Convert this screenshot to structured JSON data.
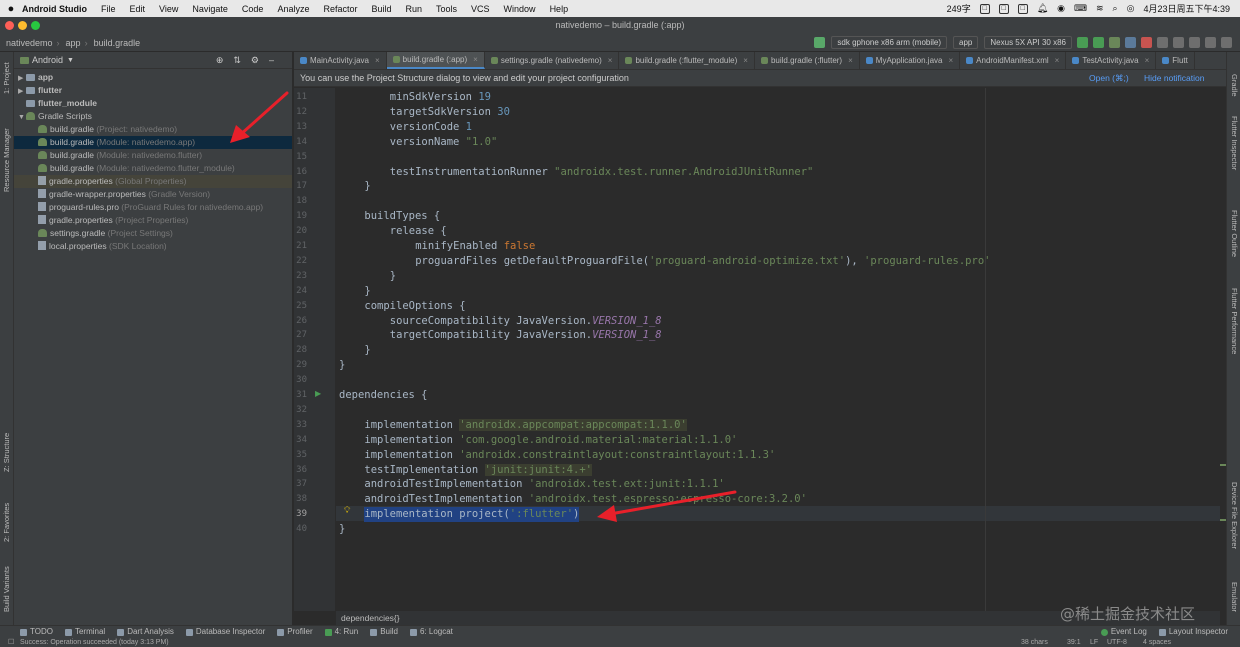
{
  "mac_menu": {
    "app_name": "Android Studio",
    "items": [
      "File",
      "Edit",
      "View",
      "Navigate",
      "Code",
      "Analyze",
      "Refactor",
      "Build",
      "Run",
      "Tools",
      "VCS",
      "Window",
      "Help"
    ],
    "ime": "249字",
    "clock": "4月23日周五下午4:39"
  },
  "window_title": "nativedemo – build.gradle (:app)",
  "navbar": {
    "crumbs": [
      "nativedemo",
      "app",
      "build.gradle"
    ],
    "device_combo": "sdk gphone x86 arm (mobile)",
    "run_config": "app",
    "avd": "Nexus 5X API 30 x86"
  },
  "project_panel": {
    "view_mode": "Android",
    "items": [
      {
        "label": "app",
        "hint": "",
        "icon": "folder-icon",
        "arrow": "▶",
        "indent": 0,
        "bold": true
      },
      {
        "label": "flutter",
        "hint": "",
        "icon": "folder-icon",
        "arrow": "▶",
        "indent": 0,
        "bold": true
      },
      {
        "label": "flutter_module",
        "hint": "",
        "icon": "folder-icon",
        "arrow": "",
        "indent": 0,
        "bold": true
      },
      {
        "label": "Gradle Scripts",
        "hint": "",
        "icon": "gradle-icon",
        "arrow": "▼",
        "indent": 0,
        "bold": false
      },
      {
        "label": "build.gradle",
        "hint": "(Project: nativedemo)",
        "icon": "gradle-icon",
        "arrow": "",
        "indent": 1,
        "bold": false
      },
      {
        "label": "build.gradle",
        "hint": "(Module: nativedemo.app)",
        "icon": "gradle-icon",
        "arrow": "",
        "indent": 1,
        "bold": false,
        "selected": true
      },
      {
        "label": "build.gradle",
        "hint": "(Module: nativedemo.flutter)",
        "icon": "gradle-icon",
        "arrow": "",
        "indent": 1,
        "bold": false
      },
      {
        "label": "build.gradle",
        "hint": "(Module: nativedemo.flutter_module)",
        "icon": "gradle-icon",
        "arrow": "",
        "indent": 1,
        "bold": false
      },
      {
        "label": "gradle.properties",
        "hint": "(Global Properties)",
        "icon": "properties-icon",
        "arrow": "",
        "indent": 1,
        "bold": false,
        "highlighted": true
      },
      {
        "label": "gradle-wrapper.properties",
        "hint": "(Gradle Version)",
        "icon": "properties-icon",
        "arrow": "",
        "indent": 1,
        "bold": false
      },
      {
        "label": "proguard-rules.pro",
        "hint": "(ProGuard Rules for nativedemo.app)",
        "icon": "file-icon",
        "arrow": "",
        "indent": 1,
        "bold": false
      },
      {
        "label": "gradle.properties",
        "hint": "(Project Properties)",
        "icon": "properties-icon",
        "arrow": "",
        "indent": 1,
        "bold": false
      },
      {
        "label": "settings.gradle",
        "hint": "(Project Settings)",
        "icon": "gradle-icon",
        "arrow": "",
        "indent": 1,
        "bold": false
      },
      {
        "label": "local.properties",
        "hint": "(SDK Location)",
        "icon": "properties-icon",
        "arrow": "",
        "indent": 1,
        "bold": false
      }
    ]
  },
  "left_stripe": [
    "1: Project",
    "Resource Manager",
    "Z: Structure",
    "2: Favorites",
    "Build Variants"
  ],
  "right_stripe": [
    "Gradle",
    "Flutter Inspector",
    "Flutter Outline",
    "Flutter Performance",
    "Device File Explorer",
    "Emulator"
  ],
  "tabs": [
    {
      "label": "MainActivity.java",
      "active": false
    },
    {
      "label": "build.gradle (:app)",
      "active": true
    },
    {
      "label": "settings.gradle (nativedemo)",
      "active": false
    },
    {
      "label": "build.gradle (:flutter_module)",
      "active": false
    },
    {
      "label": "build.gradle (:flutter)",
      "active": false
    },
    {
      "label": "MyApplication.java",
      "active": false
    },
    {
      "label": "AndroidManifest.xml",
      "active": false
    },
    {
      "label": "TestActivity.java",
      "active": false
    },
    {
      "label": "Flutt",
      "active": false
    }
  ],
  "notification": {
    "text": "You can use the Project Structure dialog to view and edit your project configuration",
    "open_link": "Open (⌘;)",
    "hide_link": "Hide notification"
  },
  "line_numbers": [
    "11",
    "12",
    "13",
    "14",
    "15",
    "16",
    "17",
    "18",
    "19",
    "20",
    "21",
    "22",
    "23",
    "24",
    "25",
    "26",
    "27",
    "28",
    "29",
    "30",
    "31",
    "32",
    "33",
    "34",
    "35",
    "36",
    "37",
    "38",
    "39",
    "40"
  ],
  "code": {
    "l11": [
      "minSdkVersion ",
      "19"
    ],
    "l12": [
      "targetSdkVersion ",
      "30"
    ],
    "l13": [
      "versionCode ",
      "1"
    ],
    "l14": [
      "versionName ",
      "\"1.0\""
    ],
    "l16": [
      "testInstrumentationRunner ",
      "\"androidx.test.runner.AndroidJUnitRunner\""
    ],
    "l17": "}",
    "l19": "buildTypes {",
    "l20": "release {",
    "l21": [
      "minifyEnabled ",
      "false"
    ],
    "l22": [
      "proguardFiles getDefaultProguardFile(",
      "'proguard-android-optimize.txt'",
      "), ",
      "'proguard-rules.pro'"
    ],
    "l23": "}",
    "l24": "}",
    "l25": "compileOptions {",
    "l26": [
      "sourceCompatibility JavaVersion.",
      "VERSION_1_8"
    ],
    "l27": [
      "targetCompatibility JavaVersion.",
      "VERSION_1_8"
    ],
    "l28": "}",
    "l29": "}",
    "l31": "dependencies {",
    "l33": [
      "implementation ",
      "'androidx.appcompat:appcompat:1.1.0'"
    ],
    "l34": [
      "implementation ",
      "'com.google.android.material:material:1.1.0'"
    ],
    "l35": [
      "implementation ",
      "'androidx.constraintlayout:constraintlayout:1.1.3'"
    ],
    "l36": [
      "testImplementation ",
      "'junit:junit:4.+'"
    ],
    "l37": [
      "androidTestImplementation ",
      "'androidx.test.ext:junit:1.1.1'"
    ],
    "l38": [
      "androidTestImplementation ",
      "'androidx.test.espresso:espresso-core:3.2.0'"
    ],
    "l39": [
      "implementation project(",
      "':flutter'",
      ")"
    ],
    "l40": "}"
  },
  "editor_breadcrumb": "dependencies{}",
  "bottom_tools": [
    "TODO",
    "Terminal",
    "Dart Analysis",
    "Database Inspector",
    "Profiler",
    "4: Run",
    "Build",
    "6: Logcat"
  ],
  "bottom_right_tools": [
    "Event Log",
    "Layout Inspector"
  ],
  "status": {
    "message": "Success: Operation succeeded (today 3:13 PM)",
    "chars": "38 chars",
    "position": "39:1",
    "lf": "LF",
    "encoding": "UTF-8",
    "indent": "4 spaces"
  },
  "watermark": "@稀土掘金技术社区",
  "colors": {
    "accent": "#4a88c7",
    "annotation_arrow": "#e8202a",
    "selection": "#0d293e"
  }
}
